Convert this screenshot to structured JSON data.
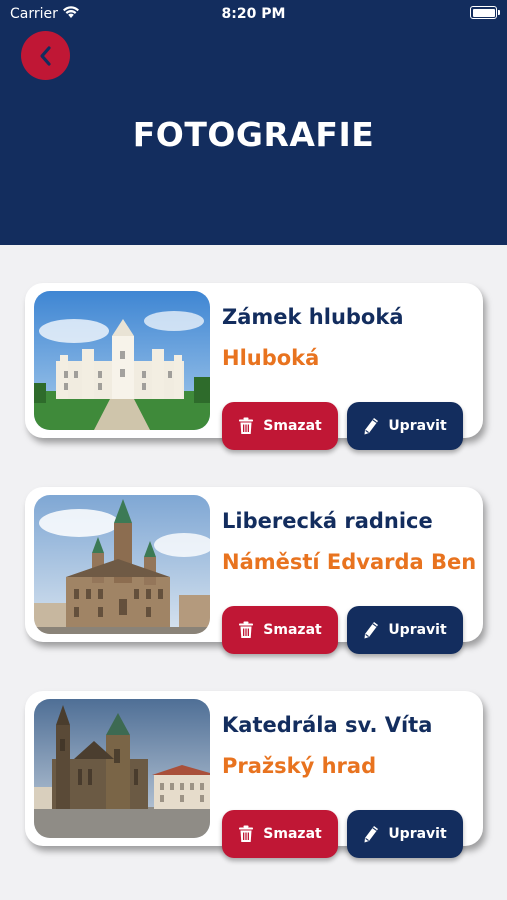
{
  "status_bar": {
    "carrier": "Carrier",
    "time": "8:20 PM"
  },
  "header": {
    "title": "FOTOGRAFIE",
    "back_icon": "chevron-left-icon"
  },
  "colors": {
    "header_bg": "#132d5e",
    "accent_red": "#c01735",
    "accent_orange": "#e8731f",
    "page_bg": "#f1f1f3"
  },
  "cards": [
    {
      "title": "Zámek hluboká",
      "subtitle": "Hluboká",
      "delete_label": "Smazat",
      "edit_label": "Upravit"
    },
    {
      "title": "Liberecká radnice",
      "subtitle": "Náměstí Edvarda Ben",
      "delete_label": "Smazat",
      "edit_label": "Upravit"
    },
    {
      "title": "Katedrála sv. Víta",
      "subtitle": "Pražský hrad",
      "delete_label": "Smazat",
      "edit_label": "Upravit"
    }
  ]
}
